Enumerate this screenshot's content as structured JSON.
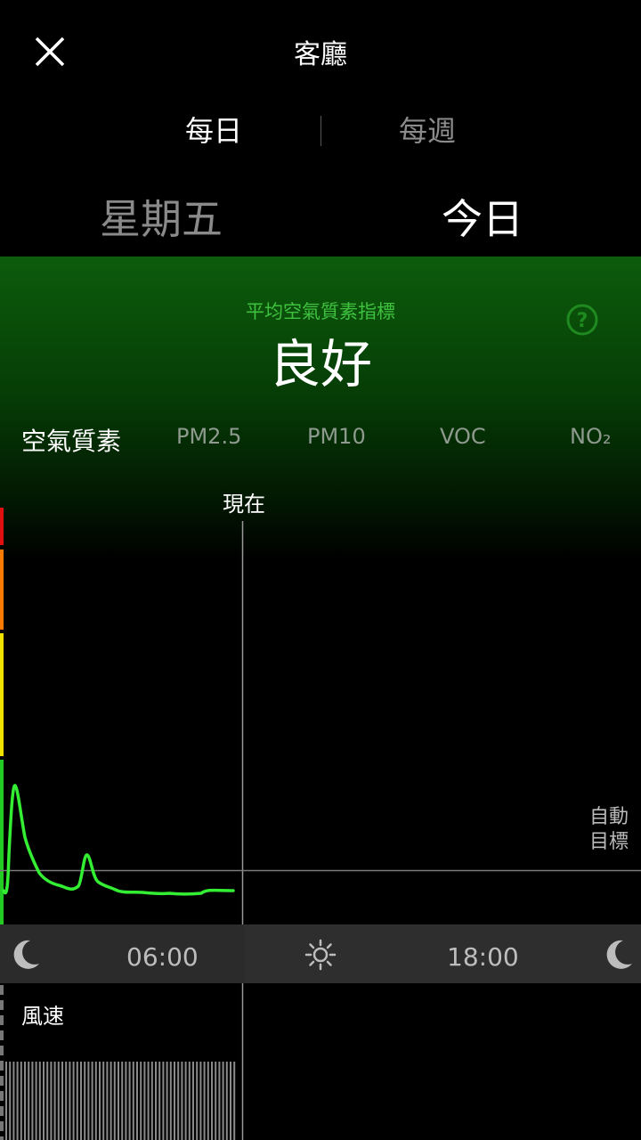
{
  "header": {
    "title": "客廳"
  },
  "period_tabs": {
    "daily": "每日",
    "weekly": "每週"
  },
  "day_tabs": {
    "previous": "星期五",
    "today": "今日"
  },
  "aqi": {
    "label": "平均空氣質素指標",
    "value": "良好",
    "help_icon": "question-circle-icon",
    "accent": "#3fc03f"
  },
  "metrics": {
    "aqi": "空氣質素",
    "pm25": "PM2.5",
    "pm10": "PM10",
    "voc": "VOC",
    "no2": "NO₂"
  },
  "chart": {
    "now_label": "現在",
    "auto_target_lines": [
      "自動",
      "目標"
    ],
    "time_axis": {
      "t06": "06:00",
      "t18": "18:00"
    },
    "scale_colors": [
      "#e01010",
      "#ff7a00",
      "#f2e200",
      "#22cc22"
    ],
    "line_color": "#33ee33"
  },
  "wind": {
    "label": "風速"
  },
  "icons": {
    "close": "close-icon",
    "moon": "moon-icon",
    "sun": "sun-icon"
  }
}
